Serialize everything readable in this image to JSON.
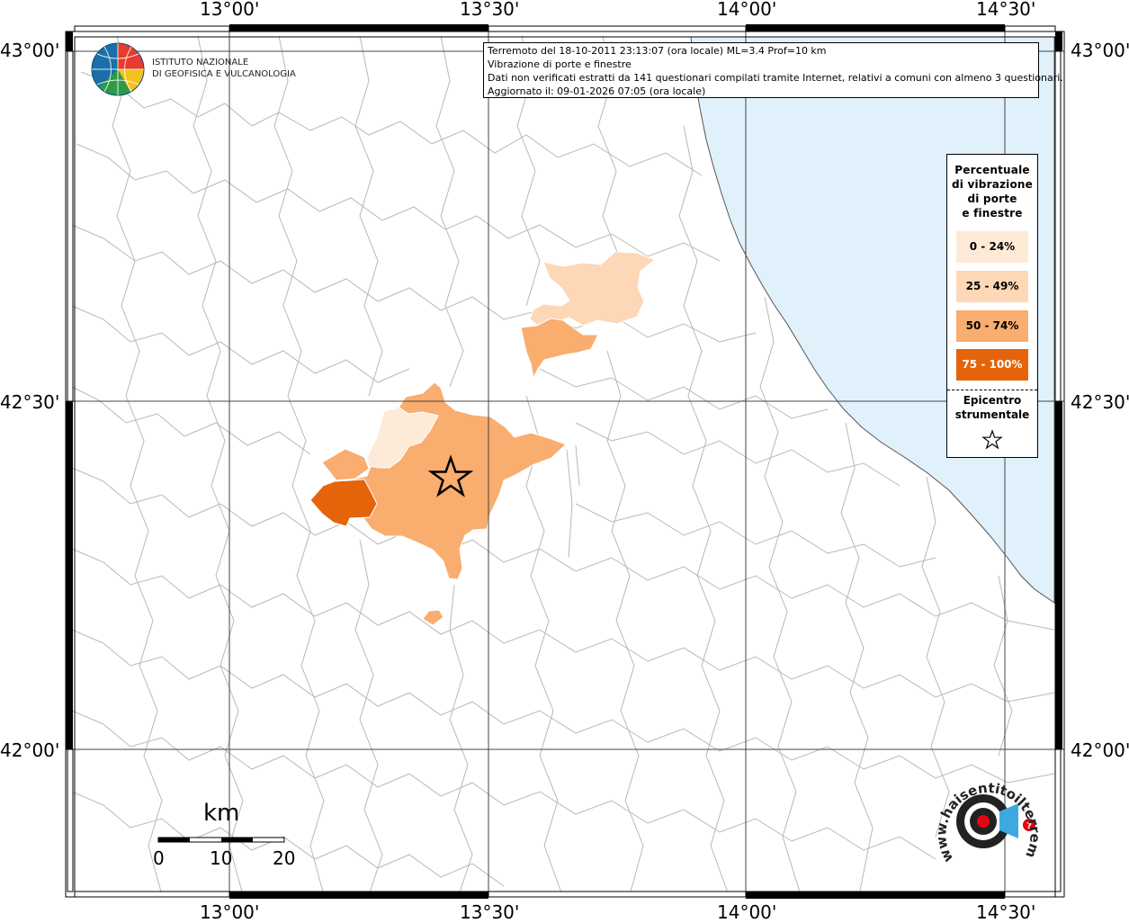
{
  "info_box": {
    "line1": "Terremoto del 18-10-2011 23:13:07 (ora locale) ML=3.4 Prof=10 km",
    "line2": "Vibrazione di porte e finestre",
    "line3": "Dati non verificati estratti da 141 questionari compilati tramite Internet, relativi a comuni con almeno 3 questionari.",
    "line4": "Aggiornato il: 09-01-2026 07:05 (ora locale)"
  },
  "institute": {
    "line1": "ISTITUTO NAZIONALE",
    "line2": "DI GEOFISICA E VULCANOLOGIA"
  },
  "axes": {
    "top": [
      "13°00'",
      "13°30'",
      "14°00'",
      "14°30'"
    ],
    "bottom": [
      "13°00'",
      "13°30'",
      "14°00'",
      "14°30'"
    ],
    "left": [
      "43°00'",
      "42°30'",
      "42°00'"
    ],
    "right": [
      "43°00'",
      "42°30'",
      "42°00'"
    ]
  },
  "legend": {
    "title_lines": [
      "Percentuale",
      "di vibrazione",
      "di porte",
      "e finestre"
    ],
    "items": [
      {
        "label": "0 - 24%",
        "color": "#fdebd8",
        "text_color": "#000000"
      },
      {
        "label": "25 - 49%",
        "color": "#fdd7b6",
        "text_color": "#000000"
      },
      {
        "label": "50 - 74%",
        "color": "#f9ad6e",
        "text_color": "#000000"
      },
      {
        "label": "75 - 100%",
        "color": "#e5640a",
        "text_color": "#ffffff"
      }
    ],
    "epicenter_lines": [
      "Epicentro",
      "strumentale"
    ]
  },
  "scale_bar": {
    "unit": "km",
    "ticks": [
      "0",
      "10",
      "20"
    ]
  },
  "logo_haisentito": {
    "text": "www.haisentitoilterremoto.it"
  },
  "colors": {
    "sea": "#e0f1fc",
    "boundaries": "#b8b8b8",
    "grid": "#333333"
  },
  "icons": {
    "epicenter": "star-icon",
    "ingv": "globe-logo-icon",
    "haisentito": "target-logo-icon"
  }
}
